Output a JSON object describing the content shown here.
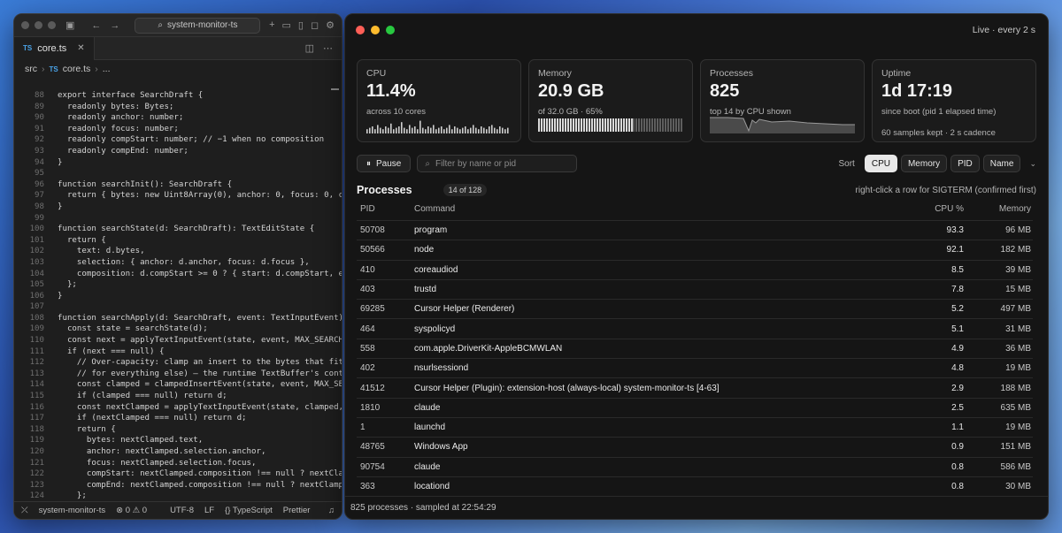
{
  "editor": {
    "search_text": "system-monitor-ts",
    "tab": {
      "badge": "TS",
      "label": "core.ts",
      "close": "✕"
    },
    "breadcrumb": [
      "src",
      "core.ts",
      "..."
    ],
    "code": [
      {
        "n": "88",
        "t": "export interface SearchDraft {"
      },
      {
        "n": "89",
        "t": "  readonly bytes: Bytes;"
      },
      {
        "n": "90",
        "t": "  readonly anchor: number;"
      },
      {
        "n": "91",
        "t": "  readonly focus: number;"
      },
      {
        "n": "92",
        "t": "  readonly compStart: number; // −1 when no composition"
      },
      {
        "n": "93",
        "t": "  readonly compEnd: number;"
      },
      {
        "n": "94",
        "t": "}"
      },
      {
        "n": "95",
        "t": ""
      },
      {
        "n": "96",
        "t": "function searchInit(): SearchDraft {"
      },
      {
        "n": "97",
        "t": "  return { bytes: new Uint8Array(0), anchor: 0, focus: 0, compSta"
      },
      {
        "n": "98",
        "t": "}"
      },
      {
        "n": "99",
        "t": ""
      },
      {
        "n": "100",
        "t": "function searchState(d: SearchDraft): TextEditState {"
      },
      {
        "n": "101",
        "t": "  return {"
      },
      {
        "n": "102",
        "t": "    text: d.bytes,"
      },
      {
        "n": "103",
        "t": "    selection: { anchor: d.anchor, focus: d.focus },"
      },
      {
        "n": "104",
        "t": "    composition: d.compStart >= 0 ? { start: d.compStart, end: d."
      },
      {
        "n": "105",
        "t": "  };"
      },
      {
        "n": "106",
        "t": "}"
      },
      {
        "n": "107",
        "t": ""
      },
      {
        "n": "108",
        "t": "function searchApply(d: SearchDraft, event: TextInputEvent): Sear"
      },
      {
        "n": "109",
        "t": "  const state = searchState(d);"
      },
      {
        "n": "110",
        "t": "  const next = applyTextInputEvent(state, event, MAX_SEARCH);"
      },
      {
        "n": "111",
        "t": "  if (next === null) {"
      },
      {
        "n": "112",
        "t": "    // Over-capacity: clamp an insert to the bytes that fit (refu"
      },
      {
        "n": "113",
        "t": "    // for everything else) — the runtime TextBuffer's contract."
      },
      {
        "n": "114",
        "t": "    const clamped = clampedInsertEvent(state, event, MAX_SEARCH);"
      },
      {
        "n": "115",
        "t": "    if (clamped === null) return d;"
      },
      {
        "n": "116",
        "t": "    const nextClamped = applyTextInputEvent(state, clamped, MAX_S"
      },
      {
        "n": "117",
        "t": "    if (nextClamped === null) return d;"
      },
      {
        "n": "118",
        "t": "    return {"
      },
      {
        "n": "119",
        "t": "      bytes: nextClamped.text,"
      },
      {
        "n": "120",
        "t": "      anchor: nextClamped.selection.anchor,"
      },
      {
        "n": "121",
        "t": "      focus: nextClamped.selection.focus,"
      },
      {
        "n": "122",
        "t": "      compStart: nextClamped.composition !== null ? nextClamped.c"
      },
      {
        "n": "123",
        "t": "      compEnd: nextClamped.composition !== null ? nextClamped.com"
      },
      {
        "n": "124",
        "t": "    };"
      },
      {
        "n": "125",
        "t": "  }"
      },
      {
        "n": "126",
        "t": "  return {"
      }
    ],
    "status": {
      "project": "system-monitor-ts",
      "problems": "⊗ 0 ⚠ 0",
      "encoding": "UTF-8",
      "eol": "LF",
      "language": "{} TypeScript",
      "formatter": "Prettier"
    }
  },
  "monitor": {
    "live_label": "Live · every 2 s",
    "cards": {
      "cpu": {
        "label": "CPU",
        "value": "11.4%",
        "sub": "across 10 cores"
      },
      "memory": {
        "label": "Memory",
        "value": "20.9 GB",
        "sub": "of 32.0 GB · 65%",
        "used_fraction": 0.65
      },
      "processes": {
        "label": "Processes",
        "value": "825",
        "sub": "top 14 by CPU shown"
      },
      "uptime": {
        "label": "Uptime",
        "value": "1d 17:19",
        "sub": "since boot (pid 1 elapsed time)",
        "sub2": "60 samples kept · 2 s cadence"
      }
    },
    "toolbar": {
      "pause_label": "Pause",
      "filter_placeholder": "Filter by name or pid",
      "sort_label": "Sort",
      "sort_options": [
        "CPU",
        "Memory",
        "PID",
        "Name"
      ],
      "sort_active": "CPU"
    },
    "processes_title": "Processes",
    "processes_count": "14 of 128",
    "hint": "right-click a row for SIGTERM (confirmed first)",
    "columns": {
      "pid": "PID",
      "command": "Command",
      "cpu": "CPU %",
      "memory": "Memory"
    },
    "rows": [
      {
        "pid": "50708",
        "cmd": "program",
        "cpu": "93.3",
        "mem": "96 MB"
      },
      {
        "pid": "50566",
        "cmd": "node",
        "cpu": "92.1",
        "mem": "182 MB"
      },
      {
        "pid": "410",
        "cmd": "coreaudiod",
        "cpu": "8.5",
        "mem": "39 MB"
      },
      {
        "pid": "403",
        "cmd": "trustd",
        "cpu": "7.8",
        "mem": "15 MB"
      },
      {
        "pid": "69285",
        "cmd": "Cursor Helper (Renderer)",
        "cpu": "5.2",
        "mem": "497 MB"
      },
      {
        "pid": "464",
        "cmd": "syspolicyd",
        "cpu": "5.1",
        "mem": "31 MB"
      },
      {
        "pid": "558",
        "cmd": "com.apple.DriverKit-AppleBCMWLAN",
        "cpu": "4.9",
        "mem": "36 MB"
      },
      {
        "pid": "402",
        "cmd": "nsurlsessiond",
        "cpu": "4.8",
        "mem": "19 MB"
      },
      {
        "pid": "41512",
        "cmd": "Cursor Helper (Plugin): extension-host (always-local) system-monitor-ts [4-63]",
        "cpu": "2.9",
        "mem": "188 MB"
      },
      {
        "pid": "1810",
        "cmd": "claude",
        "cpu": "2.5",
        "mem": "635 MB"
      },
      {
        "pid": "1",
        "cmd": "launchd",
        "cpu": "1.1",
        "mem": "19 MB"
      },
      {
        "pid": "48765",
        "cmd": "Windows App",
        "cpu": "0.9",
        "mem": "151 MB"
      },
      {
        "pid": "90754",
        "cmd": "claude",
        "cpu": "0.8",
        "mem": "586 MB"
      },
      {
        "pid": "363",
        "cmd": "locationd",
        "cpu": "0.8",
        "mem": "30 MB"
      }
    ],
    "status": "825 processes · sampled at 22:54:29",
    "colors": {
      "close": "#ff5f57",
      "minimize": "#febc2e",
      "zoom": "#28c840"
    }
  }
}
